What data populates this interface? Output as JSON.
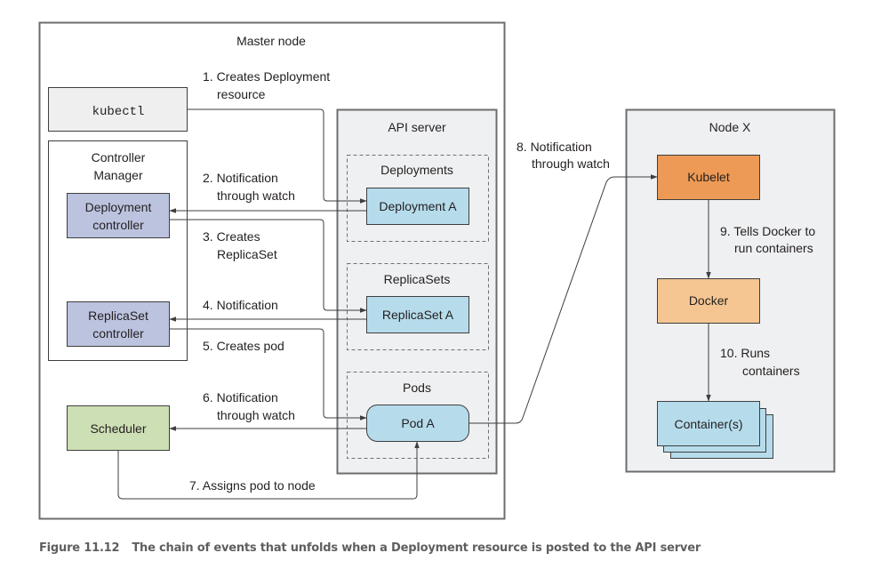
{
  "figure": {
    "number": "Figure 11.12",
    "caption": "The chain of events that unfolds when a Deployment resource is posted to the API server"
  },
  "colors": {
    "container_gray": "#eff0f1",
    "kubectl_fill": "#efeff0",
    "controller_fill": "#bcc3df",
    "scheduler_fill": "#cddfb5",
    "resource_fill": "#b6dcec",
    "kubelet_fill": "#ec9a55",
    "docker_fill": "#f5c692",
    "stroke": "#3e3e3e"
  },
  "master_node": {
    "title": "Master node",
    "kubectl": "kubectl",
    "controller_manager": {
      "title_line1": "Controller",
      "title_line2": "Manager",
      "deployment_controller_line1": "Deployment",
      "deployment_controller_line2": "controller",
      "replicaset_controller_line1": "ReplicaSet",
      "replicaset_controller_line2": "controller"
    },
    "scheduler": "Scheduler",
    "api_server": {
      "title": "API server",
      "groups": [
        {
          "title": "Deployments",
          "resource": "Deployment A"
        },
        {
          "title": "ReplicaSets",
          "resource": "ReplicaSet A"
        },
        {
          "title": "Pods",
          "resource": "Pod A"
        }
      ]
    }
  },
  "node_x": {
    "title": "Node X",
    "kubelet": "Kubelet",
    "docker": "Docker",
    "containers": "Container(s)"
  },
  "steps": [
    {
      "line1": "1. Creates Deployment",
      "line2": "resource"
    },
    {
      "line1": "2. Notification",
      "line2": "through watch"
    },
    {
      "line1": "3. Creates",
      "line2": "ReplicaSet"
    },
    {
      "line1": "4. Notification",
      "line2": ""
    },
    {
      "line1": "5. Creates pod",
      "line2": ""
    },
    {
      "line1": "6. Notification",
      "line2": "through watch"
    },
    {
      "line1": "7. Assigns pod to node",
      "line2": ""
    },
    {
      "line1": "8. Notification",
      "line2": "through watch"
    },
    {
      "line1": "9. Tells Docker to",
      "line2": "run containers"
    },
    {
      "line1": "10. Runs",
      "line2": "containers"
    }
  ]
}
